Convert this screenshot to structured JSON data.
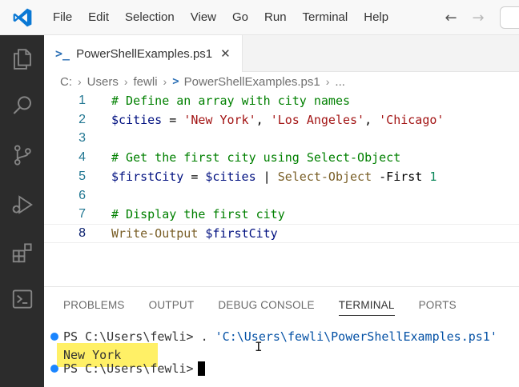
{
  "menu": {
    "items": [
      "File",
      "Edit",
      "Selection",
      "View",
      "Go",
      "Run",
      "Terminal",
      "Help"
    ],
    "back_arrow": "←",
    "forward_arrow": "→"
  },
  "tab": {
    "icon": "powershell-icon",
    "label": "PowerShellExamples.ps1",
    "close": "✕"
  },
  "breadcrumb": {
    "parts": [
      "C:",
      "Users",
      "fewli",
      "PowerShellExamples.ps1",
      "..."
    ],
    "separator": "›"
  },
  "editor": {
    "line_numbers": [
      "1",
      "2",
      "3",
      "4",
      "5",
      "6",
      "7",
      "8"
    ],
    "current_line": 8,
    "lines": [
      [
        {
          "t": "comment",
          "v": "# Define an array with city names"
        }
      ],
      [
        {
          "t": "var",
          "v": "$cities"
        },
        {
          "t": "plain",
          "v": " = "
        },
        {
          "t": "str",
          "v": "'New York'"
        },
        {
          "t": "plain",
          "v": ", "
        },
        {
          "t": "str",
          "v": "'Los Angeles'"
        },
        {
          "t": "plain",
          "v": ", "
        },
        {
          "t": "str",
          "v": "'Chicago'"
        }
      ],
      [],
      [
        {
          "t": "comment",
          "v": "# Get the first city using Select-Object"
        }
      ],
      [
        {
          "t": "var",
          "v": "$firstCity"
        },
        {
          "t": "plain",
          "v": " = "
        },
        {
          "t": "var",
          "v": "$cities"
        },
        {
          "t": "plain",
          "v": " | "
        },
        {
          "t": "cmd",
          "v": "Select-Object"
        },
        {
          "t": "plain",
          "v": " -First "
        },
        {
          "t": "num",
          "v": "1"
        }
      ],
      [],
      [
        {
          "t": "comment",
          "v": "# Display the first city"
        }
      ],
      [
        {
          "t": "cmd",
          "v": "Write-Output"
        },
        {
          "t": "plain",
          "v": " "
        },
        {
          "t": "var",
          "v": "$firstCity"
        }
      ]
    ]
  },
  "panel": {
    "tabs": [
      "PROBLEMS",
      "OUTPUT",
      "DEBUG CONSOLE",
      "TERMINAL",
      "PORTS"
    ],
    "active_tab": "TERMINAL"
  },
  "terminal": {
    "prompt": "PS C:\\Users\\fewli> ",
    "command_prefix": ". ",
    "command_path": "'C:\\Users\\fewli\\PowerShellExamples.ps1'",
    "output": "New York",
    "highlight_color": "#fff066"
  },
  "colors": {
    "activity_bar": "#2c2c2c",
    "accent_blue": "#1a85ff",
    "comment": "#008000",
    "string": "#a31515",
    "variable": "#001080",
    "command": "#795e26",
    "number": "#098658"
  }
}
